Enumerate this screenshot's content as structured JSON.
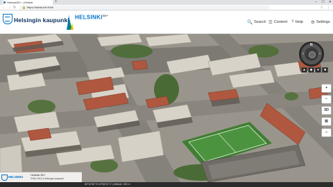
{
  "browser": {
    "tab_title": "Helsinki3D+ | Default",
    "new_tab_symbol": "+",
    "window_controls": [
      "–",
      "☐",
      "✕"
    ],
    "nav_symbols": [
      "←",
      "→",
      "↻"
    ],
    "url": "https://kartta.hel.fi/3d/",
    "address_icons": [
      "☆",
      "⋮"
    ]
  },
  "header": {
    "city_name": "Helsingin kaupunki",
    "product_name": "HELSINKI",
    "product_suffix": "3D+",
    "menu": [
      {
        "icon": "🔍",
        "label": "Search"
      },
      {
        "icon": "☰",
        "label": "Content"
      },
      {
        "icon": "?",
        "label": "Help"
      },
      {
        "icon": "⚙",
        "label": "Settings"
      }
    ]
  },
  "map_controls": {
    "compass_north": "N",
    "view_buttons": [
      "+",
      "−",
      "3D",
      "▦",
      "⌂"
    ],
    "scene_icons": [
      "▲",
      "◆",
      "●",
      "■"
    ]
  },
  "info_panel": {
    "logo_word": "HELSINKI",
    "line1": "Helsinki 3D+",
    "line2": "©HKI 2019 | Helsingin kaupunki"
  },
  "status": {
    "coords": "60°10'56\" N  24°56'04\" E  |  Altitude: 180 m"
  },
  "colors": {
    "brand_blue": "#0072c6",
    "brand_green": "#009246",
    "header_bg": "#ffffff"
  }
}
